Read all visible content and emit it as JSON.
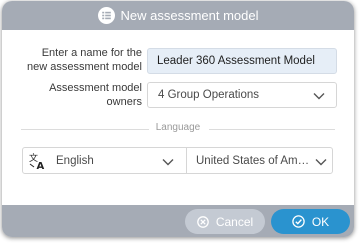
{
  "dialog": {
    "title": "New assessment model",
    "title_icon": "list-icon"
  },
  "form": {
    "name_label_line1": "Enter a name for the",
    "name_label_line2": "new assessment model",
    "name_value": "Leader 360 Assessment Model",
    "owners_label_line1": "Assessment model",
    "owners_label_line2": "owners",
    "owners_value": "4 Group Operations",
    "language_section_label": "Language",
    "language_icon": "translate-icon",
    "language_value": "English",
    "region_value": "United States of Am…"
  },
  "footer": {
    "cancel_label": "Cancel",
    "ok_label": "OK"
  },
  "colors": {
    "header_bg": "#a5abb5",
    "primary": "#2a93cf",
    "cancel_bg": "#c4cad3",
    "input_bg": "#e6eef7"
  }
}
